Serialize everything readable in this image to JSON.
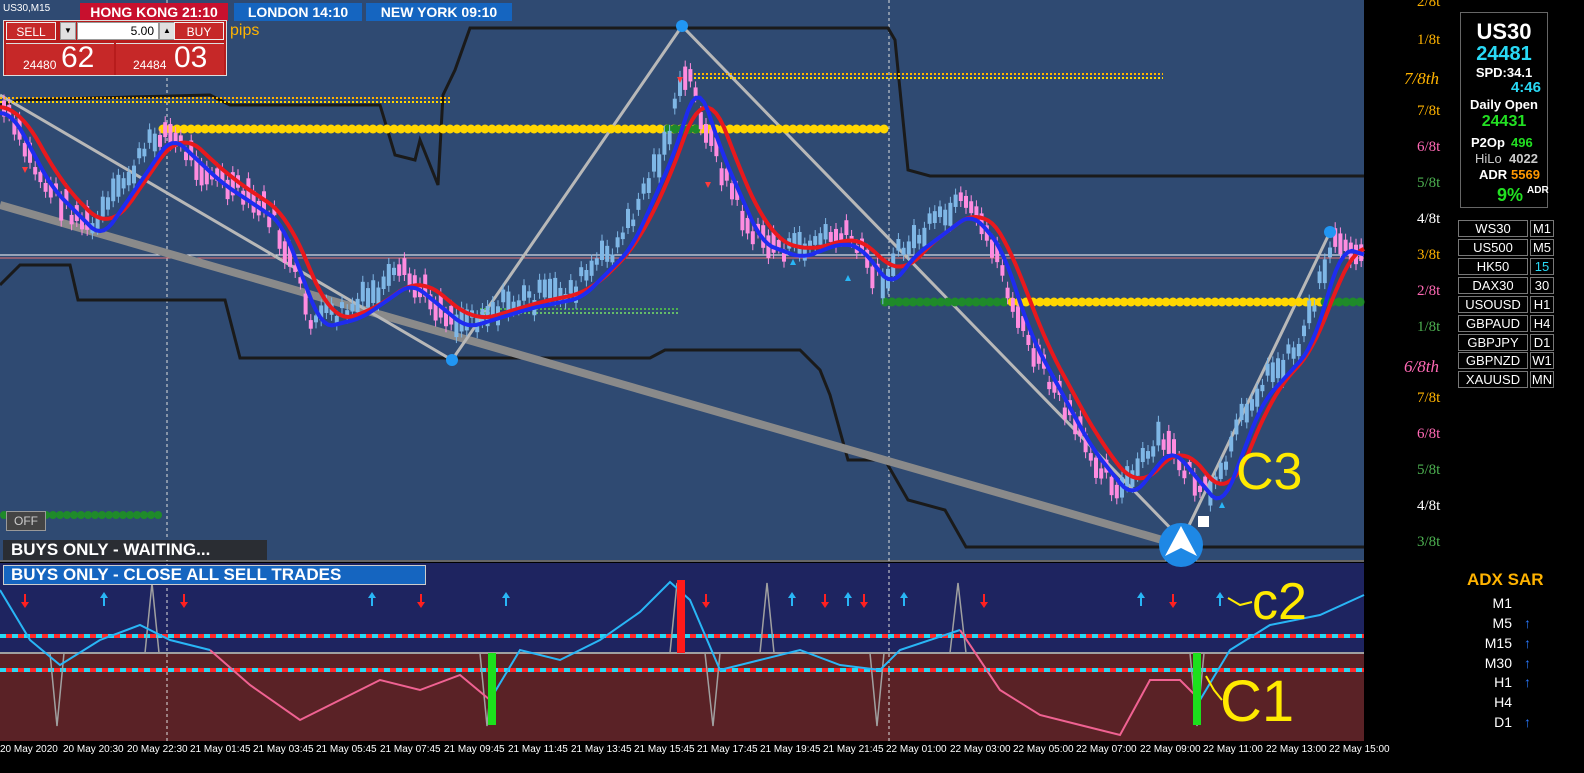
{
  "symbol_label": "US30,M15",
  "sessions": {
    "hong_kong": "HONG KONG 21:10",
    "london": "LONDON  14:10",
    "new_york": "NEW YORK  09:10"
  },
  "trade_panel": {
    "sell_label": "SELL",
    "buy_label": "BUY",
    "lot_size": "5.00",
    "bid_small": "24480",
    "bid_big": "62",
    "ask_small": "24484",
    "ask_big": "03",
    "pips_label": "pips"
  },
  "off_button": "OFF",
  "messages": {
    "waiting": "BUYS ONLY - WAITING...",
    "close_all": "BUYS ONLY - CLOSE ALL SELL TRADES"
  },
  "annotations": {
    "c3": "C3",
    "c2": "c2",
    "c1": "C1"
  },
  "right_levels": [
    {
      "text": "2/8t",
      "color": "#ffb300"
    },
    {
      "text": "1/8t",
      "color": "#ffb300"
    },
    {
      "text": "7/8th",
      "color": "#ffb300"
    },
    {
      "text": "7/8t",
      "color": "#ffb300"
    },
    {
      "text": "6/8t",
      "color": "#ff69b4"
    },
    {
      "text": "5/8t",
      "color": "#4caf50"
    },
    {
      "text": "4/8t",
      "color": "#ffffff"
    },
    {
      "text": "3/8t",
      "color": "#ffb300"
    },
    {
      "text": "2/8t",
      "color": "#ff69b4"
    },
    {
      "text": "1/8t",
      "color": "#4caf50"
    },
    {
      "text": "6/8th",
      "color": "#ff69b4"
    },
    {
      "text": "7/8t",
      "color": "#ffb300"
    },
    {
      "text": "6/8t",
      "color": "#ff69b4"
    },
    {
      "text": "5/8t",
      "color": "#4caf50"
    },
    {
      "text": "4/8t",
      "color": "#ffffff"
    },
    {
      "text": "3/8t",
      "color": "#4caf50"
    }
  ],
  "info_panel": {
    "symbol": "US30",
    "price": "24481",
    "spread": "SPD:34.1",
    "timer": "4:46",
    "daily_open_label": "Daily Open",
    "daily_open_value": "24431",
    "p2op_label": "P2Op",
    "p2op_value": "496",
    "hilo_label": "HiLo",
    "hilo_value": "4022",
    "adr_label": "ADR",
    "adr_value": "5569",
    "adr_pct": "9%",
    "adr_pct_suffix": "ADR"
  },
  "symbol_list": [
    "WS30",
    "US500",
    "HK50",
    "DAX30",
    "USOUSD",
    "GBPAUD",
    "GBPJPY",
    "GBPNZD",
    "XAUUSD"
  ],
  "timeframe_list": [
    "M1",
    "M5",
    "15",
    "30",
    "H1",
    "H4",
    "D1",
    "W1",
    "MN"
  ],
  "adx_sar": {
    "title": "ADX SAR",
    "rows": [
      {
        "tf": "M1",
        "arrow": ""
      },
      {
        "tf": "M5",
        "arrow": "↑"
      },
      {
        "tf": "M15",
        "arrow": "↑"
      },
      {
        "tf": "M30",
        "arrow": "↑"
      },
      {
        "tf": "H1",
        "arrow": "↑"
      },
      {
        "tf": "H4",
        "arrow": ""
      },
      {
        "tf": "D1",
        "arrow": "↑"
      }
    ]
  },
  "time_axis": [
    "20 May 2020",
    "20 May 20:30",
    "20 May 22:30",
    "21 May 01:45",
    "21 May 03:45",
    "21 May 05:45",
    "21 May 07:45",
    "21 May 09:45",
    "21 May 11:45",
    "21 May 13:45",
    "21 May 15:45",
    "21 May 17:45",
    "21 May 19:45",
    "21 May 21:45",
    "22 May 01:00",
    "22 May 03:00",
    "22 May 05:00",
    "22 May 07:00",
    "22 May 09:00",
    "22 May 11:00",
    "22 May 13:00",
    "22 May 15:00"
  ],
  "colors": {
    "session_red": "#7b3a4f",
    "session_blue": "#2f4a72",
    "ma_red": "#e8191d",
    "ma_blue": "#1e2cf0",
    "dots_yellow": "#ffd600",
    "dots_green": "#1f8a2a",
    "indicator_top": "#1e2460",
    "indicator_bottom": "#5a2226"
  }
}
